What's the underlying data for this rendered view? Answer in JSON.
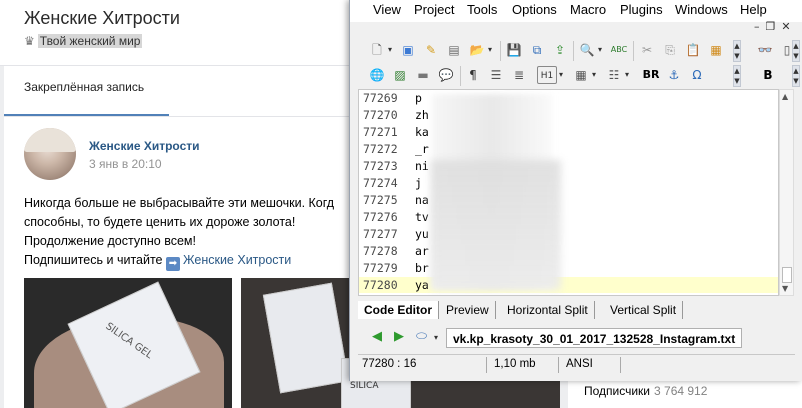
{
  "vk": {
    "page_title": "Женские Хитрости",
    "subtitle": "Твой женский мир",
    "pinned_tab": "Закреплённая запись",
    "post": {
      "author": "Женские Хитрости",
      "date": "3 янв в 20:10",
      "lines": [
        "Никогда больше не выбрасывайте эти мешочки. Когд",
        "способны, то будете ценить их дороже золота!",
        "Продолжение доступно всем!",
        "Подпишитесь и читайте"
      ],
      "link": "Женские Хитрости",
      "photo1_label": "SILICA GEL",
      "photo2_label": "SILICA"
    },
    "subscribers_label": "Подписчики",
    "subscribers_count": "3 764 912"
  },
  "editor": {
    "menu": [
      "View",
      "Project",
      "Tools",
      "Options",
      "Macro",
      "Plugins",
      "Windows",
      "Help"
    ],
    "lines": [
      {
        "num": "77269",
        "text": "p"
      },
      {
        "num": "77270",
        "text": "zh"
      },
      {
        "num": "77271",
        "text": "ka"
      },
      {
        "num": "77272",
        "text": "_r"
      },
      {
        "num": "77273",
        "text": "ni"
      },
      {
        "num": "77274",
        "text": "j"
      },
      {
        "num": "77275",
        "text": "na"
      },
      {
        "num": "77276",
        "text": "tv"
      },
      {
        "num": "77277",
        "text": "yu"
      },
      {
        "num": "77278",
        "text": "ar"
      },
      {
        "num": "77279",
        "text": "br"
      },
      {
        "num": "77280",
        "text": "ya"
      }
    ],
    "tabs": [
      "Code Editor",
      "Preview",
      "Horizontal Split",
      "Vertical Split"
    ],
    "filename": "vk.kp_krasoty_30_01_2017_132528_Instagram.txt",
    "status": {
      "position": "77280 : 16",
      "size": "1,10 mb",
      "encoding": "ANSI"
    },
    "toolbar2_labels": {
      "br": "BR",
      "b": "B",
      "h1": "H1"
    }
  }
}
